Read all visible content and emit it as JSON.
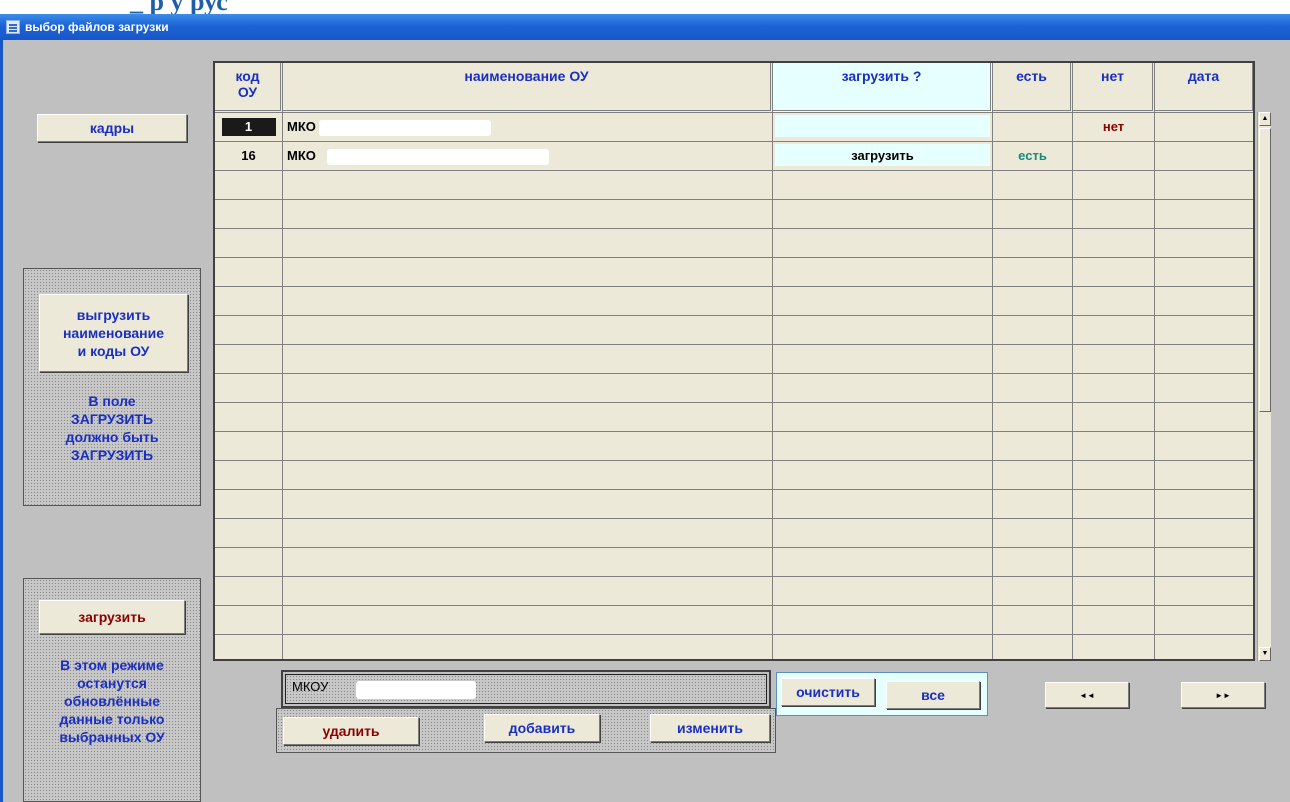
{
  "window": {
    "title": "выбор файлов загрузки",
    "background_heading": "_ р у рус"
  },
  "left": {
    "kadry_button": "кадры",
    "export_button": "выгрузить\nнаименование\nи коды  ОУ",
    "export_note": "В поле\nЗАГРУЗИТЬ\nдолжно быть\nЗАГРУЗИТЬ",
    "load_button": "загрузить",
    "load_note": "В этом режиме\nостанутся\nобновлённые\nданные только\nвыбранных ОУ"
  },
  "table": {
    "headers": {
      "kod": "код\nОУ",
      "name": "наименование ОУ",
      "load": "загрузить ?",
      "est": "есть",
      "net": "нет",
      "date": "дата"
    },
    "rows": [
      {
        "kod": "1",
        "name": "МКО",
        "load": "",
        "est": "",
        "net": "нет",
        "date": "",
        "selected": true
      },
      {
        "kod": "16",
        "name": "МКО",
        "load": "загрузить",
        "est": "есть",
        "net": "",
        "date": "",
        "selected": false
      }
    ]
  },
  "bottom": {
    "name_field_value": "МКОУ",
    "delete_button": "удалить",
    "add_button": "добавить",
    "edit_button": "изменить",
    "clear_button": "очистить",
    "all_button": "все",
    "nav_first": "◄◄",
    "nav_last": "►►"
  },
  "colors": {
    "titlebar": "#1c63d6",
    "link_text": "#1a2fc2",
    "red_text": "#8b0000",
    "est_text": "#1a8a7a",
    "load_cell": "#e6ffff"
  }
}
